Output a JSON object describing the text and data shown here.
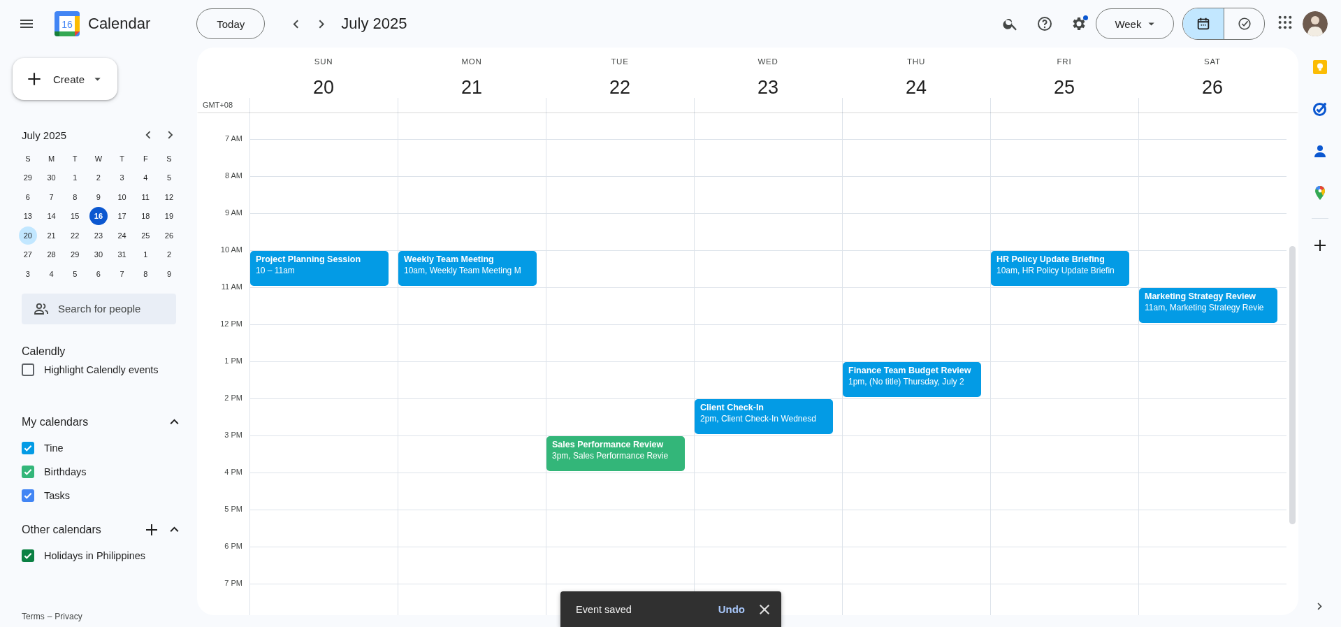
{
  "app": {
    "title": "Calendar",
    "logo_number": "16"
  },
  "toolbar": {
    "today": "Today",
    "period": "July 2025",
    "settings_badge": true,
    "view": "Week",
    "mode_toggle": [
      {
        "kind": "calendar",
        "selected": true
      },
      {
        "kind": "tasks",
        "selected": false
      }
    ]
  },
  "sidebar": {
    "create": "Create",
    "mini_calendar": {
      "title": "July 2025",
      "weekdays": [
        "S",
        "M",
        "T",
        "W",
        "T",
        "F",
        "S"
      ],
      "weeks": [
        [
          {
            "label": "29",
            "today": false,
            "selected": false
          },
          {
            "label": "30",
            "today": false,
            "selected": false
          },
          {
            "label": "1",
            "today": false,
            "selected": false
          },
          {
            "label": "2",
            "today": false,
            "selected": false
          },
          {
            "label": "3",
            "today": false,
            "selected": false
          },
          {
            "label": "4",
            "today": false,
            "selected": false
          },
          {
            "label": "5",
            "today": false,
            "selected": false
          }
        ],
        [
          {
            "label": "6",
            "today": false,
            "selected": false
          },
          {
            "label": "7",
            "today": false,
            "selected": false
          },
          {
            "label": "8",
            "today": false,
            "selected": false
          },
          {
            "label": "9",
            "today": false,
            "selected": false
          },
          {
            "label": "10",
            "today": false,
            "selected": false
          },
          {
            "label": "11",
            "today": false,
            "selected": false
          },
          {
            "label": "12",
            "today": false,
            "selected": false
          }
        ],
        [
          {
            "label": "13",
            "today": false,
            "selected": false
          },
          {
            "label": "14",
            "today": false,
            "selected": false
          },
          {
            "label": "15",
            "today": false,
            "selected": false
          },
          {
            "label": "16",
            "today": true,
            "selected": false
          },
          {
            "label": "17",
            "today": false,
            "selected": false
          },
          {
            "label": "18",
            "today": false,
            "selected": false
          },
          {
            "label": "19",
            "today": false,
            "selected": false
          }
        ],
        [
          {
            "label": "20",
            "today": false,
            "selected": true
          },
          {
            "label": "21",
            "today": false,
            "selected": false
          },
          {
            "label": "22",
            "today": false,
            "selected": false
          },
          {
            "label": "23",
            "today": false,
            "selected": false
          },
          {
            "label": "24",
            "today": false,
            "selected": false
          },
          {
            "label": "25",
            "today": false,
            "selected": false
          },
          {
            "label": "26",
            "today": false,
            "selected": false
          }
        ],
        [
          {
            "label": "27",
            "today": false,
            "selected": false
          },
          {
            "label": "28",
            "today": false,
            "selected": false
          },
          {
            "label": "29",
            "today": false,
            "selected": false
          },
          {
            "label": "30",
            "today": false,
            "selected": false
          },
          {
            "label": "31",
            "today": false,
            "selected": false
          },
          {
            "label": "1",
            "today": false,
            "selected": false
          },
          {
            "label": "2",
            "today": false,
            "selected": false
          }
        ],
        [
          {
            "label": "3",
            "today": false,
            "selected": false
          },
          {
            "label": "4",
            "today": false,
            "selected": false
          },
          {
            "label": "5",
            "today": false,
            "selected": false
          },
          {
            "label": "6",
            "today": false,
            "selected": false
          },
          {
            "label": "7",
            "today": false,
            "selected": false
          },
          {
            "label": "8",
            "today": false,
            "selected": false
          },
          {
            "label": "9",
            "today": false,
            "selected": false
          }
        ]
      ]
    },
    "people_search": {
      "placeholder": "Search for people"
    },
    "calendly": {
      "heading": "Calendly",
      "option": {
        "label": "Highlight Calendly events",
        "checked": false
      }
    },
    "sections": [
      {
        "heading": "My calendars",
        "expanded": true,
        "can_add": false,
        "calendars": [
          {
            "label": "Tine",
            "checked": true,
            "color": "#039be5"
          },
          {
            "label": "Birthdays",
            "checked": true,
            "color": "#33b679"
          },
          {
            "label": "Tasks",
            "checked": true,
            "color": "#4285f4"
          }
        ]
      },
      {
        "heading": "Other calendars",
        "expanded": true,
        "can_add": true,
        "calendars": [
          {
            "label": "Holidays in Philippines",
            "checked": true,
            "color": "#0b8043"
          }
        ]
      }
    ],
    "footer": {
      "terms": "Terms",
      "separator": "–",
      "privacy": "Privacy"
    }
  },
  "week": {
    "timezone": "GMT+08",
    "days": [
      {
        "name": "SUN",
        "number": "20"
      },
      {
        "name": "MON",
        "number": "21"
      },
      {
        "name": "TUE",
        "number": "22"
      },
      {
        "name": "WED",
        "number": "23"
      },
      {
        "name": "THU",
        "number": "24"
      },
      {
        "name": "FRI",
        "number": "25"
      },
      {
        "name": "SAT",
        "number": "26"
      }
    ],
    "hours": [
      {
        "label": "7 AM"
      },
      {
        "label": "8 AM"
      },
      {
        "label": "9 AM"
      },
      {
        "label": "10 AM",
        "cells": [
          {
            "kind": "event",
            "title": "Project Planning Session",
            "detail": "10 – 11am",
            "color": "#039be5"
          },
          {
            "kind": "event",
            "title": "Weekly Team Meeting",
            "detail": "10am, Weekly Team Meeting M",
            "color": "#039be5"
          },
          {
            "kind": "free"
          },
          {
            "kind": "free"
          },
          {
            "kind": "free"
          },
          {
            "kind": "event",
            "title": "HR Policy Update Briefing",
            "detail": "10am, HR Policy Update Briefin",
            "color": "#039be5"
          },
          {
            "kind": "free"
          }
        ]
      },
      {
        "label": "11 AM",
        "cells": [
          {
            "kind": "free"
          },
          {
            "kind": "free"
          },
          {
            "kind": "free"
          },
          {
            "kind": "free"
          },
          {
            "kind": "free"
          },
          {
            "kind": "free"
          },
          {
            "kind": "event",
            "title": "Marketing Strategy Review",
            "detail": "11am, Marketing Strategy Revie",
            "color": "#039be5"
          }
        ]
      },
      {
        "label": "12 PM"
      },
      {
        "label": "1 PM",
        "cells": [
          {
            "kind": "free"
          },
          {
            "kind": "free"
          },
          {
            "kind": "free"
          },
          {
            "kind": "free"
          },
          {
            "kind": "event",
            "title": "Finance Team Budget Review",
            "detail": "1pm, (No title) Thursday, July 2",
            "color": "#039be5"
          },
          {
            "kind": "free"
          },
          {
            "kind": "free"
          }
        ]
      },
      {
        "label": "2 PM",
        "cells": [
          {
            "kind": "free"
          },
          {
            "kind": "free"
          },
          {
            "kind": "free"
          },
          {
            "kind": "event",
            "title": "Client Check-In",
            "detail": "2pm, Client Check-In Wednesd",
            "color": "#039be5"
          },
          {
            "kind": "free"
          },
          {
            "kind": "free"
          },
          {
            "kind": "free"
          }
        ]
      },
      {
        "label": "3 PM",
        "cells": [
          {
            "kind": "free"
          },
          {
            "kind": "free"
          },
          {
            "kind": "event",
            "title": "Sales Performance Review",
            "detail": "3pm, Sales Performance Revie",
            "color": "#33b679"
          },
          {
            "kind": "free"
          },
          {
            "kind": "free"
          },
          {
            "kind": "free"
          },
          {
            "kind": "free"
          }
        ]
      },
      {
        "label": "4 PM"
      },
      {
        "label": "5 PM"
      },
      {
        "label": "6 PM"
      },
      {
        "label": "7 PM"
      }
    ]
  },
  "side_rail": [
    {
      "kind": "keep"
    },
    {
      "kind": "tasks"
    },
    {
      "kind": "contacts"
    },
    {
      "kind": "maps"
    }
  ],
  "toast": {
    "message": "Event saved",
    "action": "Undo"
  }
}
